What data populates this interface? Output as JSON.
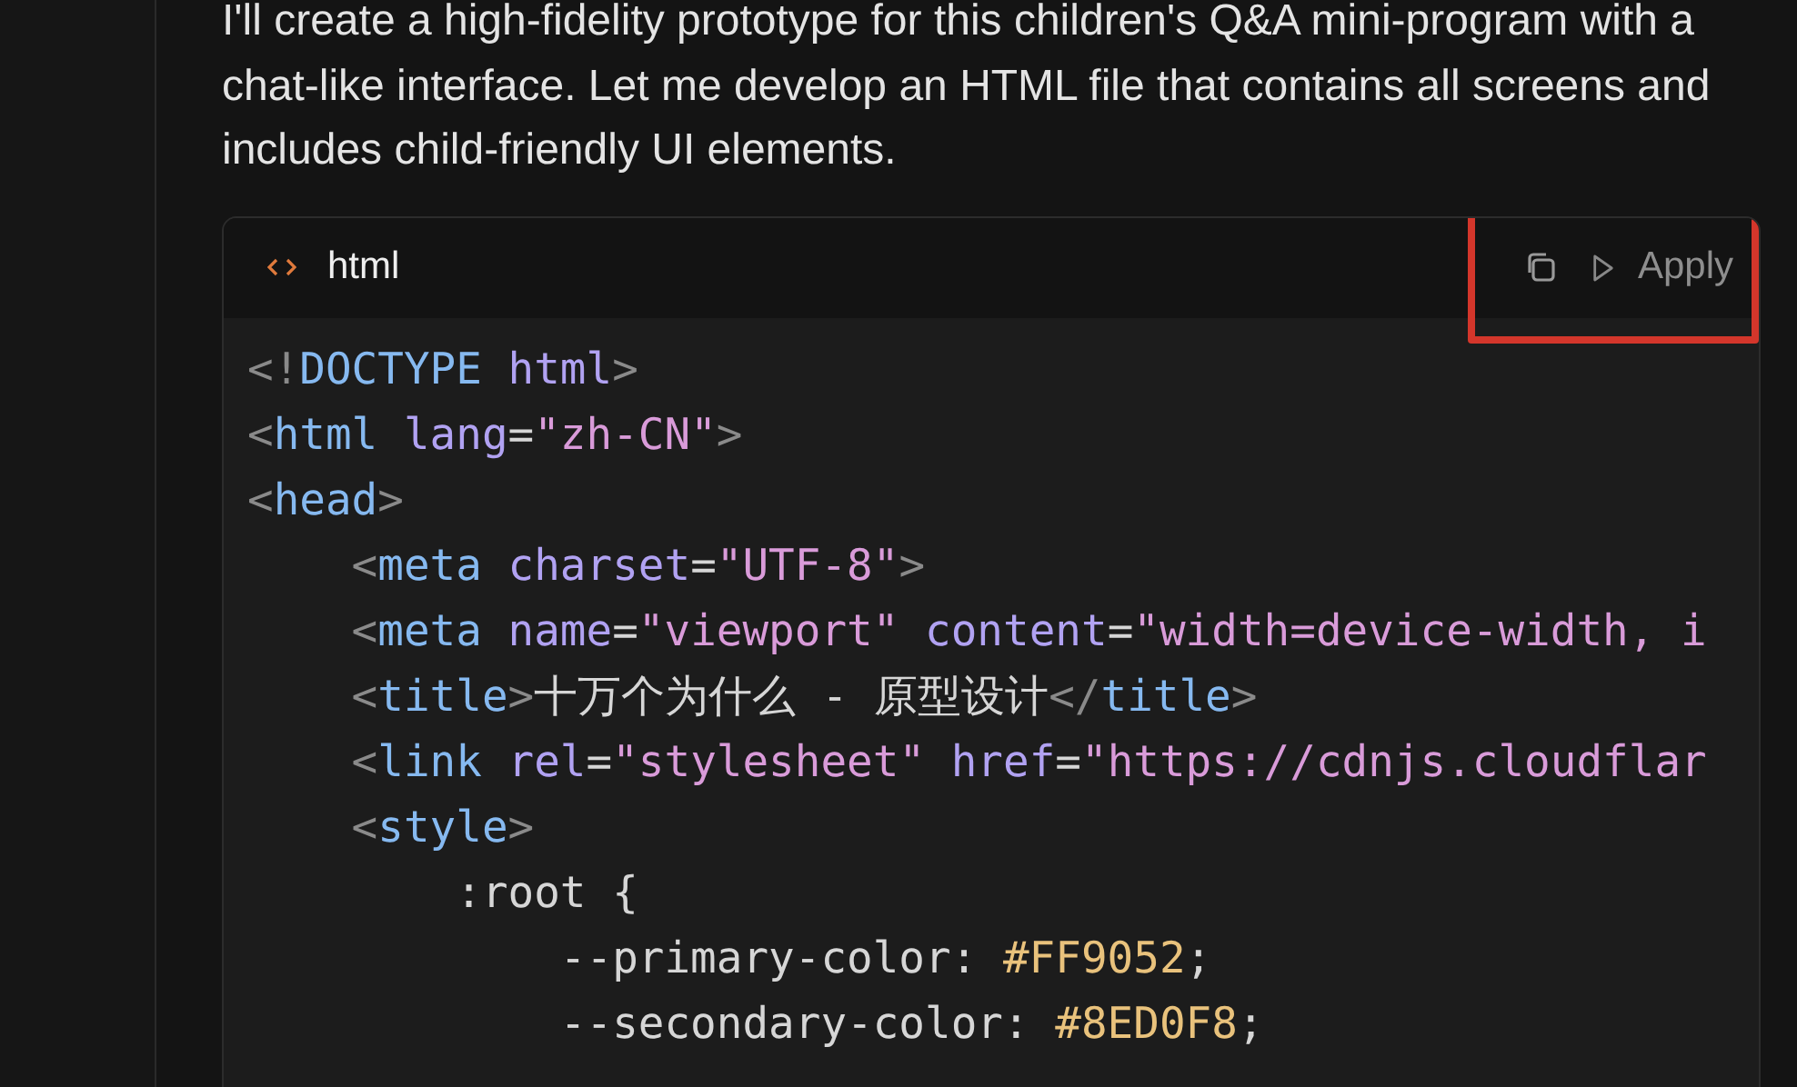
{
  "message": {
    "text": "I'll create a high-fidelity prototype for this children's Q&A mini-program with a chat-like interface. Let me develop an HTML file that contains all screens and includes child-friendly UI elements."
  },
  "code_block": {
    "language": "html",
    "actions": [
      {
        "kind": "copy"
      },
      {
        "kind": "apply",
        "label": "Apply"
      }
    ],
    "highlighted": true,
    "lines": [
      [
        {
          "kind": "punct",
          "text": "<!"
        },
        {
          "kind": "tag",
          "text": "DOCTYPE"
        },
        {
          "kind": "attr",
          "text": " html"
        },
        {
          "kind": "punct",
          "text": ">"
        }
      ],
      [
        {
          "kind": "punct",
          "text": "<"
        },
        {
          "kind": "tag",
          "text": "html"
        },
        {
          "kind": "attr",
          "text": " lang"
        },
        {
          "kind": "plain",
          "text": "="
        },
        {
          "kind": "string",
          "text": "\"zh-CN\""
        },
        {
          "kind": "punct",
          "text": ">"
        }
      ],
      [
        {
          "kind": "punct",
          "text": "<"
        },
        {
          "kind": "tag",
          "text": "head"
        },
        {
          "kind": "punct",
          "text": ">"
        }
      ],
      [
        {
          "kind": "punct",
          "text": "    <"
        },
        {
          "kind": "tag",
          "text": "meta"
        },
        {
          "kind": "attr",
          "text": " charset"
        },
        {
          "kind": "plain",
          "text": "="
        },
        {
          "kind": "string",
          "text": "\"UTF-8\""
        },
        {
          "kind": "punct",
          "text": ">"
        }
      ],
      [
        {
          "kind": "punct",
          "text": "    <"
        },
        {
          "kind": "tag",
          "text": "meta"
        },
        {
          "kind": "attr",
          "text": " name"
        },
        {
          "kind": "plain",
          "text": "="
        },
        {
          "kind": "string",
          "text": "\"viewport\""
        },
        {
          "kind": "attr",
          "text": " content"
        },
        {
          "kind": "plain",
          "text": "="
        },
        {
          "kind": "string",
          "text": "\"width=device-width, i"
        }
      ],
      [
        {
          "kind": "punct",
          "text": "    <"
        },
        {
          "kind": "tag",
          "text": "title"
        },
        {
          "kind": "punct",
          "text": ">"
        },
        {
          "kind": "plain",
          "text": "十万个为什么 - 原型设计"
        },
        {
          "kind": "punct",
          "text": "</"
        },
        {
          "kind": "tag",
          "text": "title"
        },
        {
          "kind": "punct",
          "text": ">"
        }
      ],
      [
        {
          "kind": "punct",
          "text": "    <"
        },
        {
          "kind": "tag",
          "text": "link"
        },
        {
          "kind": "attr",
          "text": " rel"
        },
        {
          "kind": "plain",
          "text": "="
        },
        {
          "kind": "string",
          "text": "\"stylesheet\""
        },
        {
          "kind": "attr",
          "text": " href"
        },
        {
          "kind": "plain",
          "text": "="
        },
        {
          "kind": "string",
          "text": "\"https://cdnjs.cloudflar"
        }
      ],
      [
        {
          "kind": "punct",
          "text": "    <"
        },
        {
          "kind": "tag",
          "text": "style"
        },
        {
          "kind": "punct",
          "text": ">"
        }
      ],
      [
        {
          "kind": "plain",
          "text": "        :root {"
        }
      ],
      [
        {
          "kind": "plain",
          "text": "            --primary-color: "
        },
        {
          "kind": "value",
          "text": "#FF9052"
        },
        {
          "kind": "plain",
          "text": ";"
        }
      ],
      [
        {
          "kind": "plain",
          "text": "            --secondary-color: "
        },
        {
          "kind": "value",
          "text": "#8ED0F8"
        },
        {
          "kind": "plain",
          "text": ";"
        }
      ]
    ]
  }
}
